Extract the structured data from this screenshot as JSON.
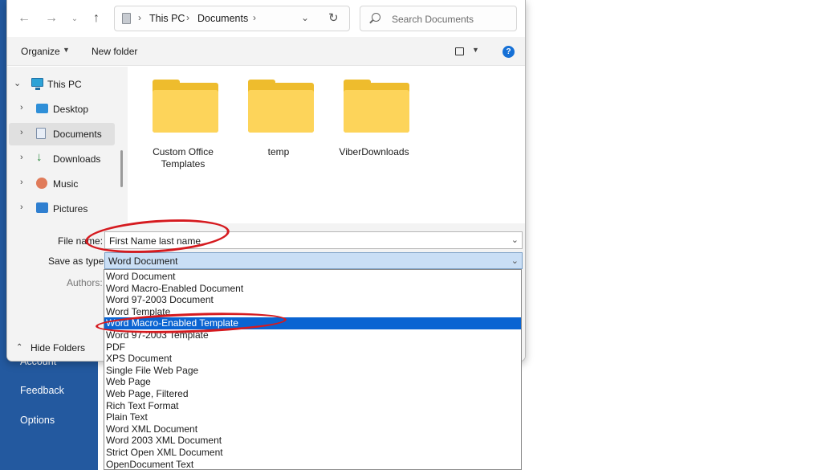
{
  "backstage": {
    "items": [
      "Account",
      "Feedback",
      "Options"
    ]
  },
  "address_bar": {
    "breadcrumbs": [
      "This PC",
      "Documents"
    ],
    "search_placeholder": "Search Documents"
  },
  "toolbar": {
    "organize_label": "Organize",
    "new_folder_label": "New folder"
  },
  "nav": {
    "items": [
      {
        "label": "This PC",
        "icon": "computer-icon",
        "expanded": true,
        "selected": false
      },
      {
        "label": "Desktop",
        "icon": "desktop-icon",
        "expanded": false,
        "selected": false
      },
      {
        "label": "Documents",
        "icon": "documents-icon",
        "expanded": false,
        "selected": true
      },
      {
        "label": "Downloads",
        "icon": "download-icon",
        "expanded": false,
        "selected": false
      },
      {
        "label": "Music",
        "icon": "music-icon",
        "expanded": false,
        "selected": false
      },
      {
        "label": "Pictures",
        "icon": "pictures-icon",
        "expanded": false,
        "selected": false
      }
    ]
  },
  "folders": [
    {
      "label": "Custom Office\nTemplates"
    },
    {
      "label": "temp"
    },
    {
      "label": "ViberDownloads"
    }
  ],
  "form": {
    "file_name_label": "File name:",
    "file_name_value": "First Name last name",
    "save_type_label": "Save as type:",
    "save_type_value": "Word Document",
    "authors_label": "Authors:"
  },
  "hide_folders_label": "Hide Folders",
  "save_type_options": [
    "Word Document",
    "Word Macro-Enabled Document",
    "Word 97-2003 Document",
    "Word Template",
    "Word Macro-Enabled Template",
    "Word 97-2003 Template",
    "PDF",
    "XPS Document",
    "Single File Web Page",
    "Web Page",
    "Web Page, Filtered",
    "Rich Text Format",
    "Plain Text",
    "Word XML Document",
    "Word 2003 XML Document",
    "Strict Open XML Document",
    "OpenDocument Text"
  ],
  "highlighted_option": "Word Macro-Enabled Template",
  "colors": {
    "accent": "#0a64d2",
    "annotation": "#d51a1f",
    "backstage": "#23599f",
    "folder": "#fdd45a"
  }
}
